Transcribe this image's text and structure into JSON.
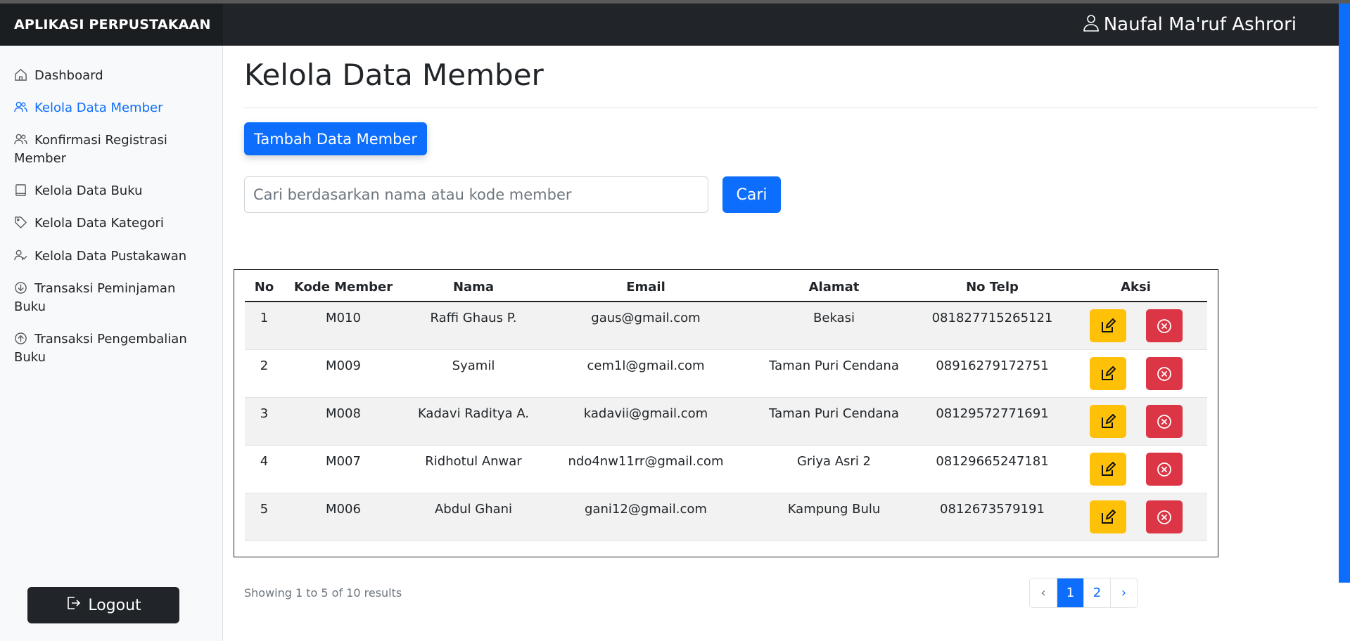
{
  "app": {
    "brand": "APLIKASI PERPUSTAKAAN",
    "user_name": "Naufal Ma'ruf Ashrori"
  },
  "sidebar": {
    "items": [
      {
        "label": "Dashboard",
        "icon": "home-icon"
      },
      {
        "label": "Kelola Data Member",
        "icon": "users-icon",
        "active": true
      },
      {
        "label": "Konfirmasi Registrasi Member",
        "icon": "users-icon"
      },
      {
        "label": "Kelola Data Buku",
        "icon": "book-icon"
      },
      {
        "label": "Kelola Data Kategori",
        "icon": "tag-icon"
      },
      {
        "label": "Kelola Data Pustakawan",
        "icon": "user-check-icon"
      },
      {
        "label": "Transaksi Peminjaman Buku",
        "icon": "arrow-down-circle-icon"
      },
      {
        "label": "Transaksi Pengembalian Buku",
        "icon": "arrow-up-circle-icon"
      }
    ],
    "logout_label": "Logout"
  },
  "main": {
    "title": "Kelola Data Member",
    "add_button": "Tambah Data Member",
    "search": {
      "placeholder": "Cari berdasarkan nama atau kode member",
      "value": "",
      "button": "Cari"
    }
  },
  "table": {
    "columns": [
      "No",
      "Kode Member",
      "Nama",
      "Email",
      "Alamat",
      "No Telp",
      "Aksi"
    ],
    "rows": [
      {
        "no": "1",
        "kode": "M010",
        "nama": "Raffi Ghaus P.",
        "email": "gaus@gmail.com",
        "alamat": "Bekasi",
        "telp": "081827715265121"
      },
      {
        "no": "2",
        "kode": "M009",
        "nama": "Syamil",
        "email": "cem1l@gmail.com",
        "alamat": "Taman Puri Cendana",
        "telp": "08916279172751"
      },
      {
        "no": "3",
        "kode": "M008",
        "nama": "Kadavi Raditya A.",
        "email": "kadavii@gmail.com",
        "alamat": "Taman Puri Cendana",
        "telp": "08129572771691"
      },
      {
        "no": "4",
        "kode": "M007",
        "nama": "Ridhotul Anwar",
        "email": "ndo4nw11rr@gmail.com",
        "alamat": "Griya Asri 2",
        "telp": "08129665247181"
      },
      {
        "no": "5",
        "kode": "M006",
        "nama": "Abdul Ghani",
        "email": "gani12@gmail.com",
        "alamat": "Kampung Bulu",
        "telp": "0812673579191"
      }
    ]
  },
  "pagination": {
    "summary": "Showing 1 to 5 of 10 results",
    "prev": "‹",
    "pages": [
      "1",
      "2"
    ],
    "current": "1",
    "next": "›"
  },
  "colors": {
    "primary": "#0d6efd",
    "dark": "#212529",
    "warning": "#ffc107",
    "danger": "#dc3545"
  }
}
